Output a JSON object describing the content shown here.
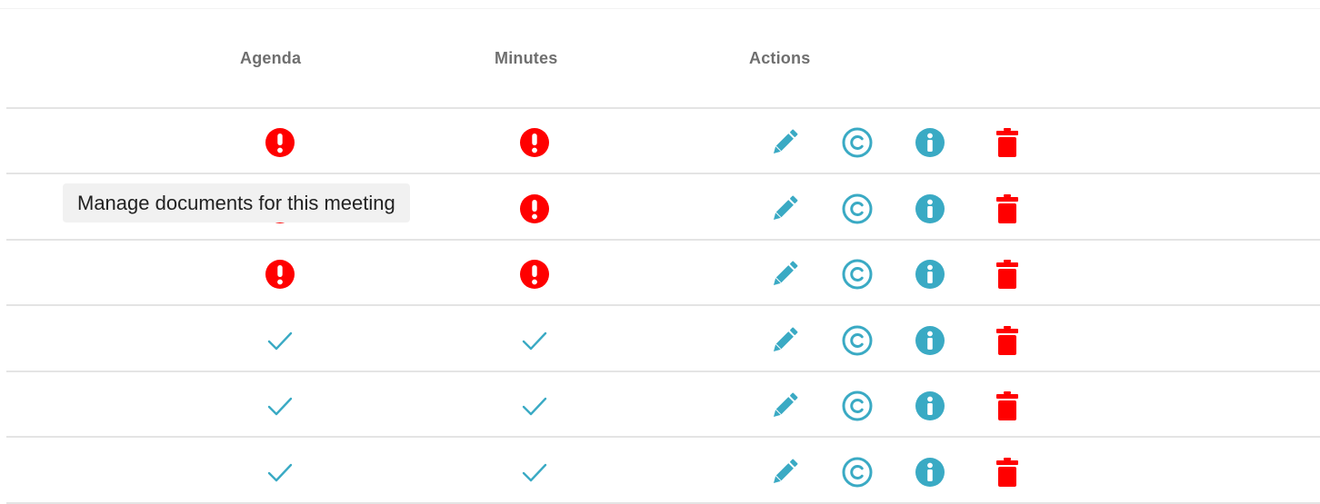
{
  "colors": {
    "alert_red": "#ff0000",
    "accent_teal": "#3aaac4",
    "delete_red": "#ff0000",
    "header_text": "#6f6f6f"
  },
  "columns": {
    "agenda": "Agenda",
    "minutes": "Minutes",
    "actions": "Actions"
  },
  "tooltip": {
    "text": "Manage documents for this meeting"
  },
  "rows": [
    {
      "agenda_status": "missing",
      "minutes_status": "missing"
    },
    {
      "agenda_status": "missing",
      "minutes_status": "missing"
    },
    {
      "agenda_status": "missing",
      "minutes_status": "missing"
    },
    {
      "agenda_status": "complete",
      "minutes_status": "complete"
    },
    {
      "agenda_status": "complete",
      "minutes_status": "complete"
    },
    {
      "agenda_status": "complete",
      "minutes_status": "complete"
    }
  ],
  "icons": {
    "missing": "exclamation-circle-icon",
    "complete": "checkmark-icon",
    "edit": "pencil-icon",
    "copy": "copyright-icon",
    "info": "info-circle-icon",
    "delete": "trash-icon"
  }
}
